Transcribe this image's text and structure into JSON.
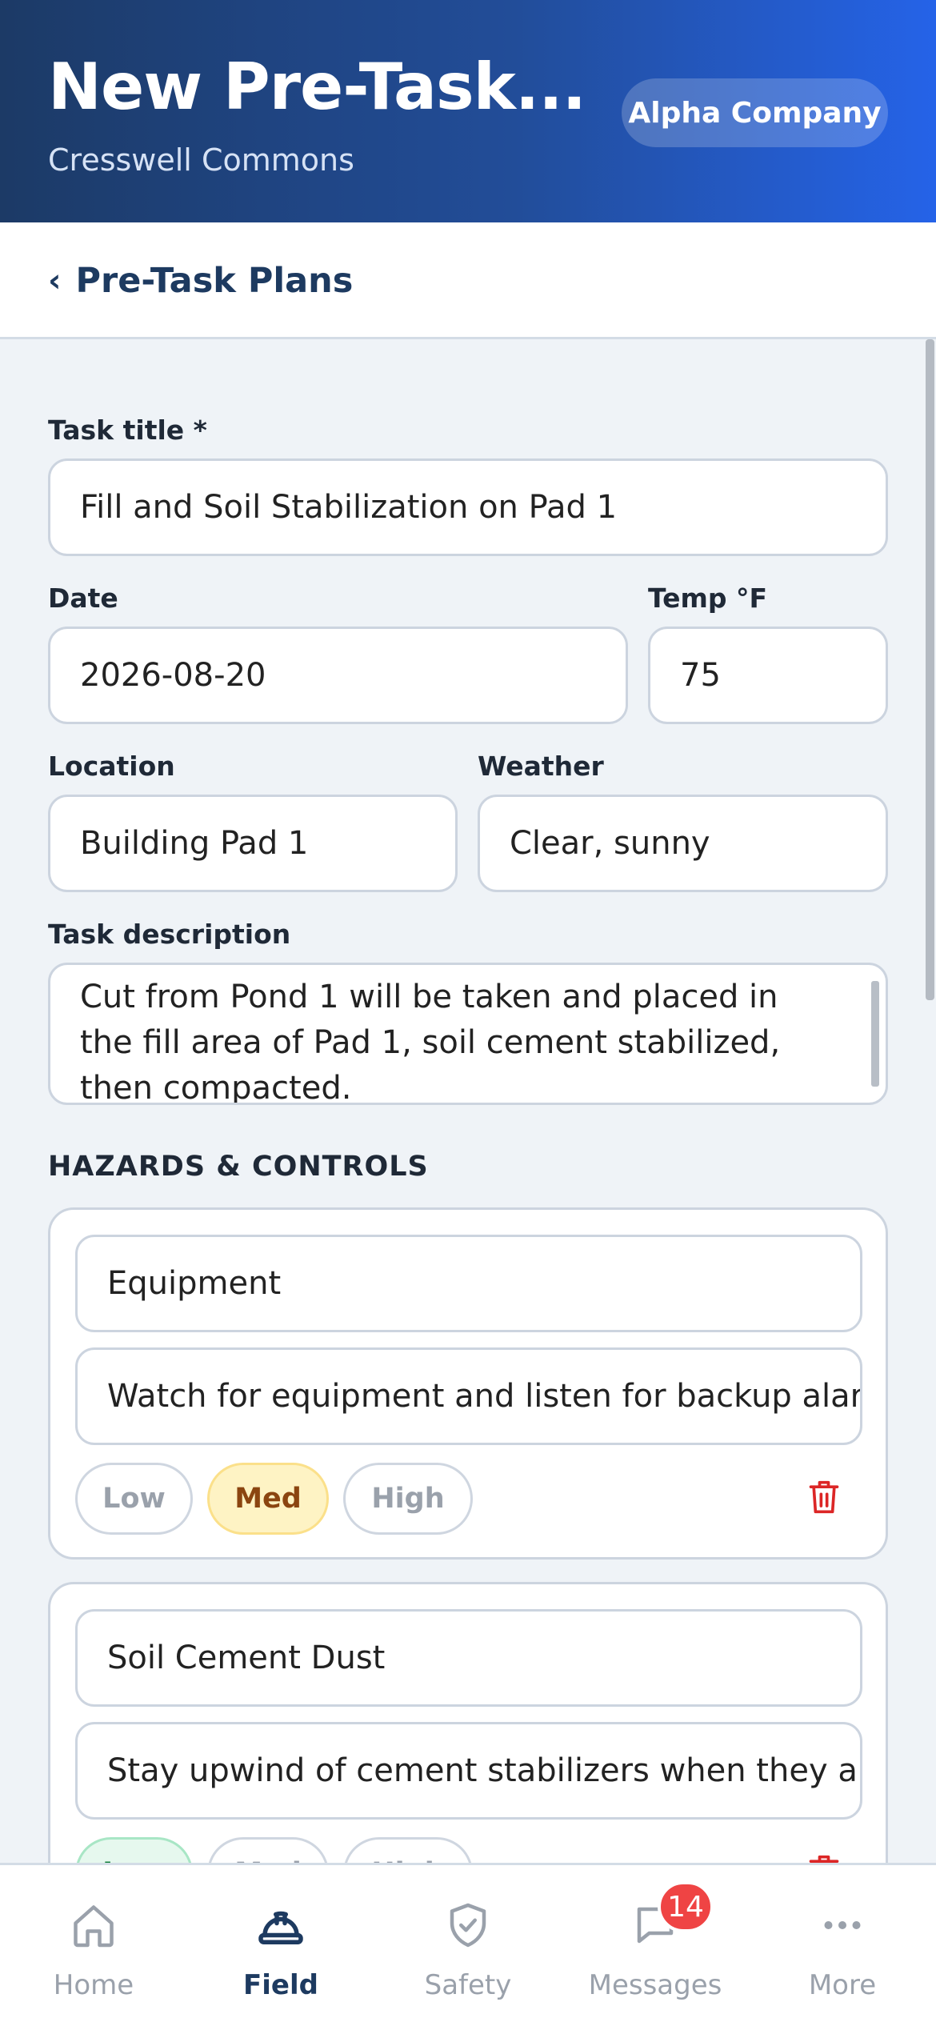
{
  "header": {
    "title": "New Pre-Task...",
    "project": "Cresswell Commons",
    "company": "Alpha Company"
  },
  "nav": {
    "back_label": "Pre-Task Plans"
  },
  "form": {
    "task_title_label": "Task title *",
    "task_title_value": "Fill and Soil Stabilization on Pad 1",
    "date_label": "Date",
    "date_value": "2026-08-20",
    "temp_label": "Temp °F",
    "temp_value": "75",
    "location_label": "Location",
    "location_value": "Building Pad 1",
    "weather_label": "Weather",
    "weather_value": "Clear, sunny",
    "description_label": "Task description",
    "description_value": "Cut from Pond 1 will be taken and placed in the fill area of Pad 1, soil cement stabilized, then compacted."
  },
  "hazards": {
    "section_title": "HAZARDS & CONTROLS",
    "level_labels": [
      "Low",
      "Med",
      "High"
    ],
    "items": [
      {
        "hazard": "Equipment",
        "control": "Watch for equipment and listen for backup alarms",
        "selected_level": "Med"
      },
      {
        "hazard": "Soil Cement Dust",
        "control": "Stay upwind of cement stabilizers when they are in use",
        "selected_level": "Low"
      }
    ]
  },
  "tabs": [
    {
      "label": "Home",
      "icon": "home-icon",
      "active": false
    },
    {
      "label": "Field",
      "icon": "hard-hat-icon",
      "active": true
    },
    {
      "label": "Safety",
      "icon": "shield-check-icon",
      "active": false
    },
    {
      "label": "Messages",
      "icon": "message-icon",
      "active": false,
      "badge": "14"
    },
    {
      "label": "More",
      "icon": "more-icon",
      "active": false
    }
  ],
  "colors": {
    "header_start": "#1c3a66",
    "header_end": "#2563e8",
    "primary_text": "#1d3a60",
    "danger": "#dc2626",
    "badge": "#ef4444"
  }
}
